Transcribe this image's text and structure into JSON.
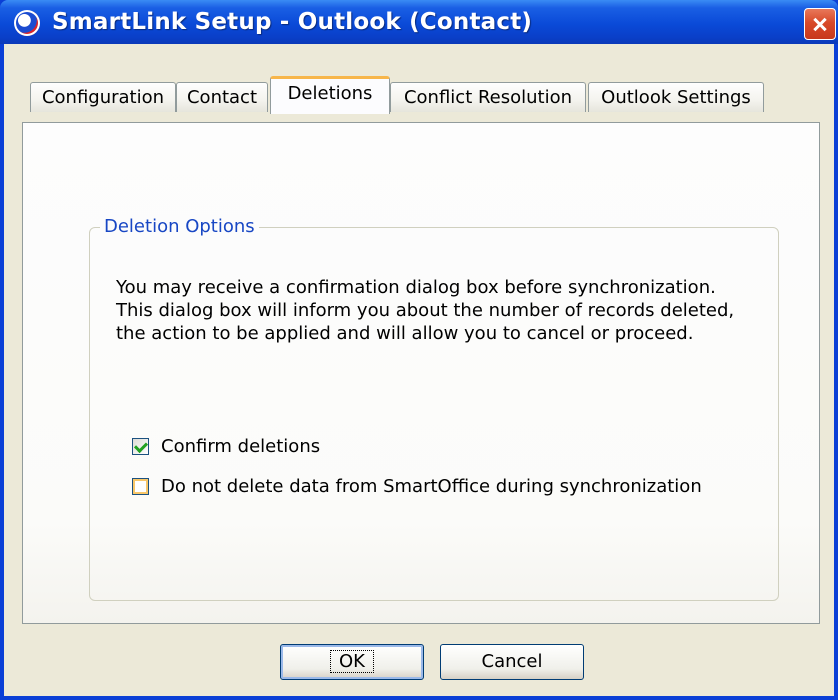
{
  "window": {
    "title": "SmartLink Setup - Outlook (Contact)",
    "icon": "smartlink-app-icon",
    "close_icon": "close-icon"
  },
  "tabs": [
    {
      "label": "Configuration",
      "active": false
    },
    {
      "label": "Contact",
      "active": false
    },
    {
      "label": "Deletions",
      "active": true
    },
    {
      "label": "Conflict Resolution",
      "active": false
    },
    {
      "label": "Outlook Settings",
      "active": false
    }
  ],
  "group": {
    "title": "Deletion Options",
    "description_lines": [
      "You may receive a confirmation dialog box before synchronization.",
      "This dialog box will inform you about the number of records deleted,",
      "the action to be applied and will allow you to cancel or proceed."
    ],
    "options": [
      {
        "label": "Confirm deletions",
        "checked": true
      },
      {
        "label": "Do not delete data from SmartOffice during synchronization",
        "checked": false
      }
    ]
  },
  "buttons": {
    "ok": "OK",
    "cancel": "Cancel"
  },
  "colors": {
    "titlebar": "#0a4ad8",
    "active_tab_accent": "#f7b64b",
    "group_title": "#1847c4",
    "checkmark": "#21a121"
  }
}
